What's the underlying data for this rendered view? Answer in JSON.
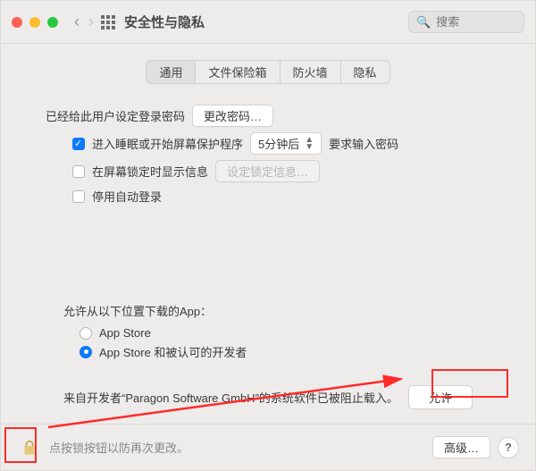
{
  "header": {
    "title": "安全性与隐私",
    "search_placeholder": "搜索"
  },
  "tabs": [
    {
      "label": "通用",
      "active": true
    },
    {
      "label": "文件保险箱",
      "active": false
    },
    {
      "label": "防火墙",
      "active": false
    },
    {
      "label": "隐私",
      "active": false
    }
  ],
  "general": {
    "password_set_label": "已经给此用户设定登录密码",
    "change_password_btn": "更改密码…",
    "require_password_cb": {
      "checked": true,
      "label_before": "进入睡眠或开始屏幕保护程序",
      "select_value": "5分钟后",
      "label_after": "要求输入密码"
    },
    "show_message_cb": {
      "checked": false,
      "label": "在屏幕锁定时显示信息"
    },
    "set_message_btn": "设定锁定信息…",
    "disable_autologin_cb": {
      "checked": false,
      "label": "停用自动登录"
    }
  },
  "download": {
    "heading": "允许从以下位置下载的App：",
    "options": [
      {
        "label": "App Store",
        "checked": false
      },
      {
        "label": "App Store 和被认可的开发者",
        "checked": true
      }
    ]
  },
  "blocked": {
    "text": "来自开发者“Paragon Software GmbH”的系统软件已被阻止载入。",
    "allow_btn": "允许"
  },
  "footer": {
    "text": "点按锁按钮以防再次更改。",
    "advanced_btn": "高级…"
  }
}
